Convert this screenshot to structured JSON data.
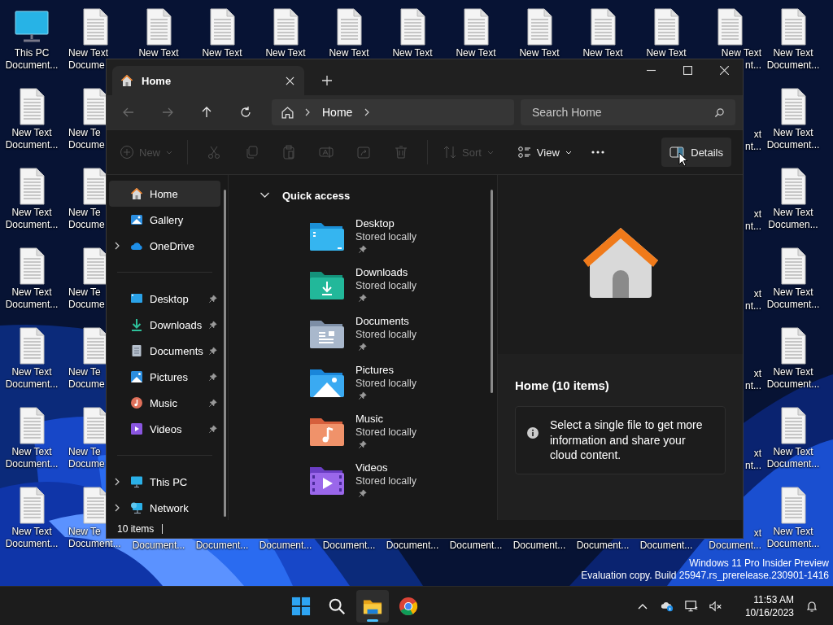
{
  "desktop": {
    "columns": [
      [
        {
          "kind": "pc",
          "lines": [
            "This PC",
            "Document..."
          ]
        },
        {
          "kind": "text-file",
          "lines": [
            "New Text",
            "Document..."
          ]
        },
        {
          "kind": "text-file",
          "lines": [
            "New Text",
            "Document..."
          ]
        },
        {
          "kind": "text-file",
          "lines": [
            "New Text",
            "Document..."
          ]
        },
        {
          "kind": "text-file",
          "lines": [
            "New Text",
            "Document..."
          ]
        },
        {
          "kind": "text-file",
          "lines": [
            "New Text",
            "Document..."
          ]
        },
        {
          "kind": "text-file",
          "lines": [
            "New Text",
            "Document..."
          ]
        }
      ],
      [
        {
          "kind": "text-file",
          "lines": [
            "New Text",
            "Docume"
          ]
        },
        {
          "kind": "text-file",
          "lines": [
            "New Te",
            "Docume"
          ]
        },
        {
          "kind": "text-file",
          "lines": [
            "New Te",
            "Docume"
          ]
        },
        {
          "kind": "text-file",
          "lines": [
            "New Te",
            "Docume"
          ]
        },
        {
          "kind": "text-file",
          "lines": [
            "New Te",
            "Docume"
          ]
        },
        {
          "kind": "text-file",
          "lines": [
            "New Te",
            "Docume"
          ]
        },
        {
          "kind": "text-file",
          "lines": [
            "New Te",
            "Document..."
          ]
        }
      ],
      [
        {
          "kind": "text-file",
          "lines": [
            "New Text"
          ]
        },
        {
          "kind": "covered",
          "lines": [
            "Document..."
          ]
        }
      ],
      [
        {
          "kind": "text-file",
          "lines": [
            "New Text"
          ]
        },
        {
          "kind": "covered",
          "lines": [
            "Document..."
          ]
        }
      ],
      [
        {
          "kind": "text-file",
          "lines": [
            "New Text"
          ]
        },
        {
          "kind": "covered",
          "lines": [
            "Document..."
          ]
        }
      ],
      [
        {
          "kind": "text-file",
          "lines": [
            "New Text"
          ]
        },
        {
          "kind": "covered",
          "lines": [
            "Document..."
          ]
        }
      ],
      [
        {
          "kind": "text-file",
          "lines": [
            "New Text"
          ]
        },
        {
          "kind": "covered",
          "lines": [
            "Document..."
          ]
        }
      ],
      [
        {
          "kind": "text-file",
          "lines": [
            "New Text"
          ]
        },
        {
          "kind": "covered",
          "lines": [
            "Document..."
          ]
        }
      ],
      [
        {
          "kind": "text-file",
          "lines": [
            "New Text"
          ]
        },
        {
          "kind": "covered",
          "lines": [
            "Document..."
          ]
        }
      ],
      [
        {
          "kind": "text-file",
          "lines": [
            "New Text"
          ]
        },
        {
          "kind": "covered",
          "lines": [
            "Document..."
          ]
        }
      ],
      [
        {
          "kind": "text-file",
          "lines": [
            "New Text"
          ]
        },
        {
          "kind": "covered",
          "lines": [
            "Document..."
          ]
        }
      ],
      [
        {
          "kind": "text-file",
          "lines": [
            "New Text",
            "nt..."
          ]
        },
        {
          "kind": "covered",
          "lines": [
            "xt",
            "nt..."
          ]
        },
        {
          "kind": "covered",
          "lines": [
            "xt",
            "nt..."
          ]
        },
        {
          "kind": "covered",
          "lines": [
            "xt",
            "nt..."
          ]
        },
        {
          "kind": "covered",
          "lines": [
            "xt",
            "nt..."
          ]
        },
        {
          "kind": "covered",
          "lines": [
            "xt",
            "nt..."
          ]
        },
        {
          "kind": "covered",
          "lines": [
            "xt",
            "Document..."
          ]
        }
      ],
      [
        {
          "kind": "text-file",
          "lines": [
            "New Text",
            "Document..."
          ]
        },
        {
          "kind": "text-file",
          "lines": [
            "New Text",
            "Document..."
          ]
        },
        {
          "kind": "text-file",
          "lines": [
            "New Text",
            "Documen..."
          ]
        },
        {
          "kind": "text-file",
          "lines": [
            "New Text",
            "Document..."
          ]
        },
        {
          "kind": "text-file",
          "lines": [
            "New Text",
            "Document..."
          ]
        },
        {
          "kind": "text-file",
          "lines": [
            "New Text",
            "Document..."
          ]
        },
        {
          "kind": "text-file",
          "lines": [
            "New Text",
            "Document..."
          ]
        }
      ]
    ]
  },
  "explorer": {
    "tabs": [
      {
        "label": "Home",
        "selected": true
      }
    ],
    "nav": [
      {
        "kind": "back",
        "disabled": true
      },
      {
        "kind": "forward",
        "disabled": true
      },
      {
        "kind": "up",
        "disabled": false
      },
      {
        "kind": "refresh",
        "disabled": false
      }
    ],
    "breadcrumb": [
      "Home"
    ],
    "search": {
      "placeholder": "Search Home"
    },
    "toolbar": [
      {
        "kind": "new",
        "label": "New",
        "disabled": true
      },
      {
        "kind": "cut",
        "disabled": true
      },
      {
        "kind": "copy",
        "disabled": true
      },
      {
        "kind": "paste",
        "disabled": true
      },
      {
        "kind": "rename",
        "disabled": true
      },
      {
        "kind": "share",
        "disabled": true
      },
      {
        "kind": "delete",
        "disabled": true
      },
      {
        "kind": "sort",
        "label": "Sort",
        "disabled": true
      },
      {
        "kind": "view",
        "label": "View",
        "disabled": false
      },
      {
        "kind": "more",
        "disabled": false
      }
    ],
    "details_button": {
      "label": "Details",
      "selected": true
    },
    "sidebar": [
      [
        {
          "kind": "home",
          "label": "Home",
          "selected": true,
          "expandable": false,
          "pinned": false
        },
        {
          "kind": "gallery",
          "label": "Gallery",
          "selected": false,
          "expandable": false,
          "pinned": false
        },
        {
          "kind": "onedrive",
          "label": "OneDrive",
          "selected": false,
          "expandable": true,
          "pinned": false
        }
      ],
      [
        {
          "kind": "desktop",
          "label": "Desktop",
          "selected": false,
          "expandable": false,
          "pinned": true
        },
        {
          "kind": "downloads",
          "label": "Downloads",
          "selected": false,
          "expandable": false,
          "pinned": true
        },
        {
          "kind": "documents",
          "label": "Documents",
          "selected": false,
          "expandable": false,
          "pinned": true
        },
        {
          "kind": "pictures",
          "label": "Pictures",
          "selected": false,
          "expandable": false,
          "pinned": true
        },
        {
          "kind": "music",
          "label": "Music",
          "selected": false,
          "expandable": false,
          "pinned": true
        },
        {
          "kind": "videos",
          "label": "Videos",
          "selected": false,
          "expandable": false,
          "pinned": true
        }
      ],
      [
        {
          "kind": "pc",
          "label": "This PC",
          "selected": false,
          "expandable": true,
          "pinned": false
        },
        {
          "kind": "network",
          "label": "Network",
          "selected": false,
          "expandable": true,
          "pinned": false
        }
      ]
    ],
    "quick_access": {
      "title": "Quick access",
      "expanded": true,
      "items": [
        {
          "kind": "desktop",
          "name": "Desktop",
          "status": "Stored locally",
          "pinned": true
        },
        {
          "kind": "downloads",
          "name": "Downloads",
          "status": "Stored locally",
          "pinned": true
        },
        {
          "kind": "documents",
          "name": "Documents",
          "status": "Stored locally",
          "pinned": true
        },
        {
          "kind": "pictures",
          "name": "Pictures",
          "status": "Stored locally",
          "pinned": true
        },
        {
          "kind": "music",
          "name": "Music",
          "status": "Stored locally",
          "pinned": true
        },
        {
          "kind": "videos",
          "name": "Videos",
          "status": "Stored locally",
          "pinned": true
        }
      ]
    },
    "details": {
      "title": "Home (10 items)",
      "info": "Select a single file to get more information and share your cloud content."
    },
    "status_bar": {
      "count": "10 items"
    }
  },
  "watermark": [
    "Windows 11 Pro Insider Preview",
    "Evaluation copy. Build 25947.rs_prerelease.230901-1416"
  ],
  "taskbar": {
    "apps": [
      {
        "kind": "start",
        "active": false
      },
      {
        "kind": "search",
        "active": false
      },
      {
        "kind": "explorer",
        "active": true
      },
      {
        "kind": "browser",
        "active": false
      }
    ],
    "tray": [
      {
        "kind": "chevron"
      },
      {
        "kind": "cloud"
      },
      {
        "kind": "network"
      },
      {
        "kind": "speaker-muted"
      }
    ],
    "time": "11:53 AM",
    "date": "10/16/2023"
  }
}
